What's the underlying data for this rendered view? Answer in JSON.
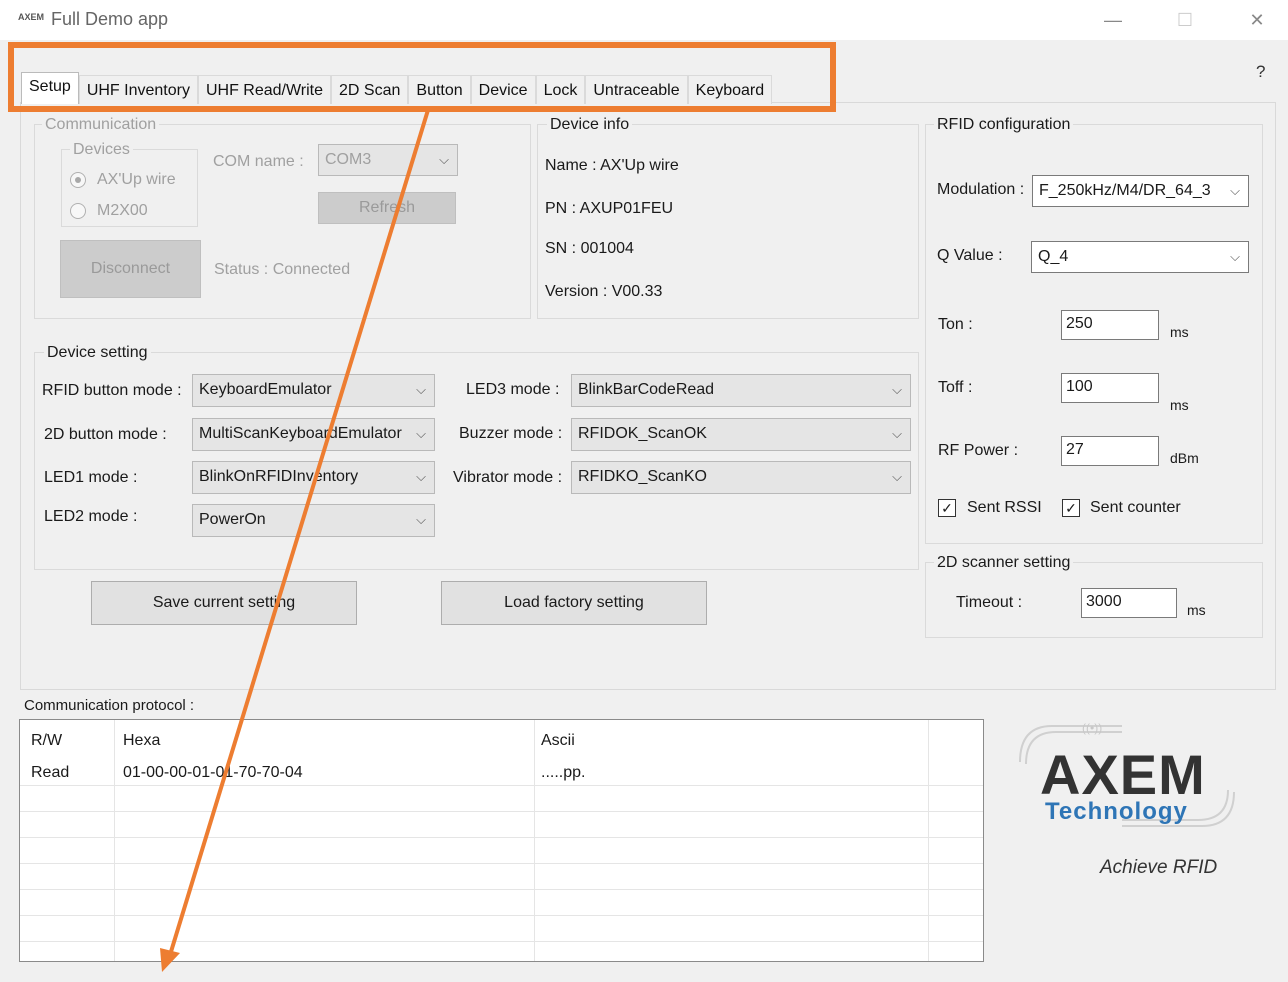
{
  "window": {
    "title": "Full Demo app",
    "logo_text": "AXEM",
    "minimize_icon": "—",
    "maximize_icon": "☐",
    "close_icon": "✕"
  },
  "help": "?",
  "tabs": [
    "Setup",
    "UHF Inventory",
    "UHF Read/Write",
    "2D Scan",
    "Button",
    "Device",
    "Lock",
    "Untraceable",
    "Keyboard"
  ],
  "communication": {
    "title": "Communication",
    "devices_title": "Devices",
    "device_options": [
      "AX'Up wire",
      "M2X00"
    ],
    "com_name_label": "COM name :",
    "com_name_value": "COM3",
    "refresh_label": "Refresh",
    "disconnect_label": "Disconnect",
    "status": "Status : Connected"
  },
  "device_info": {
    "title": "Device info",
    "name": "Name : AX'Up wire",
    "pn": "PN : AXUP01FEU",
    "sn": "SN : 001004",
    "version": "Version : V00.33"
  },
  "device_setting": {
    "title": "Device setting",
    "rfid_button_label": "RFID button mode :",
    "rfid_button_value": "KeyboardEmulator",
    "scan_button_label": "2D button mode :",
    "scan_button_value": "MultiScanKeyboardEmulator",
    "led1_label": "LED1 mode :",
    "led1_value": "BlinkOnRFIDInventory",
    "led2_label": "LED2 mode :",
    "led2_value": "PowerOn",
    "led3_label": "LED3 mode :",
    "led3_value": "BlinkBarCodeRead",
    "buzzer_label": "Buzzer mode :",
    "buzzer_value": "RFIDOK_ScanOK",
    "vibrator_label": "Vibrator mode :",
    "vibrator_value": "RFIDKO_ScanKO"
  },
  "buttons": {
    "save": "Save current setting",
    "load": "Load factory setting"
  },
  "rfid_config": {
    "title": "RFID configuration",
    "modulation_label": "Modulation :",
    "modulation_value": "F_250kHz/M4/DR_64_3",
    "q_label": "Q Value :",
    "q_value": "Q_4",
    "ton_label": "Ton :",
    "ton_value": "250",
    "ton_unit": "ms",
    "toff_label": "Toff :",
    "toff_value": "100",
    "toff_unit": "ms",
    "power_label": "RF Power :",
    "power_value": "27",
    "power_unit": "dBm",
    "sent_rssi": "Sent RSSI",
    "sent_counter": "Sent counter",
    "check_mark": "✓"
  },
  "scanner_setting": {
    "title": "2D scanner setting",
    "timeout_label": "Timeout :",
    "timeout_value": "3000",
    "timeout_unit": "ms"
  },
  "protocol": {
    "title": "Communication protocol :",
    "columns": [
      "R/W",
      "Hexa",
      "Ascii"
    ],
    "rows": [
      {
        "rw": "Read",
        "hexa": "01-00-00-01-01-70-70-04",
        "ascii": ".....pp."
      }
    ]
  },
  "logo": {
    "name": "AXEM",
    "sub": "Technology",
    "tagline": "Achieve RFID",
    "color": "#2e75b6"
  },
  "annotation": {
    "color": "#ed7d31"
  }
}
